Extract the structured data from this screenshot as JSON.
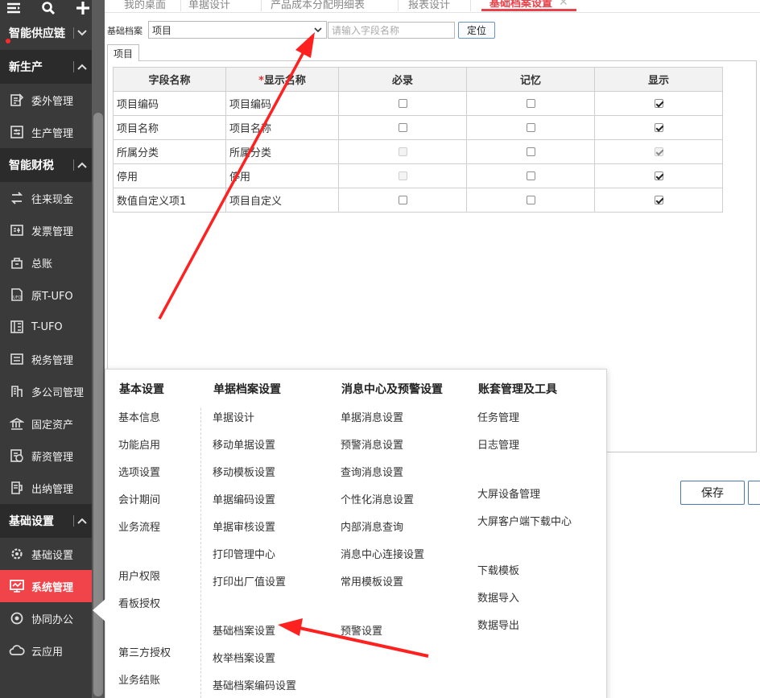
{
  "sidebar": {
    "groups": [
      {
        "label": "智能供应链",
        "items": []
      },
      {
        "label": "新生产",
        "items": [
          "委外管理",
          "生产管理"
        ]
      },
      {
        "label": "智能财税",
        "items": [
          "往来现金",
          "发票管理",
          "总账",
          "原T-UFO",
          "T-UFO",
          "税务管理",
          "多公司管理",
          "固定资产",
          "薪资管理",
          "出纳管理"
        ]
      },
      {
        "label": "基础设置",
        "items": [
          "基础设置",
          "系统管理",
          "协同办公",
          "云应用"
        ]
      }
    ],
    "active_item": "系统管理"
  },
  "tabs": [
    "我的桌面",
    "单据设计",
    "产品成本分配明细表",
    "报表设计",
    "基础档案设置"
  ],
  "active_tab": "基础档案设置",
  "filter": {
    "label": "基础档案",
    "selected": "项目",
    "search_placeholder": "请输入字段名称",
    "locate_label": "定位"
  },
  "subtab": "项目",
  "grid": {
    "headers": [
      "字段名称",
      "显示名称",
      "必录",
      "记忆",
      "显示"
    ],
    "rows": [
      {
        "field": "项目编码",
        "display": "项目编码",
        "required": false,
        "required_disabled": false,
        "memory": false,
        "show": true,
        "show_disabled": false
      },
      {
        "field": "项目名称",
        "display": "项目名称",
        "required": false,
        "required_disabled": false,
        "memory": false,
        "show": true,
        "show_disabled": false
      },
      {
        "field": "所属分类",
        "display": "所属分类",
        "required": false,
        "required_disabled": true,
        "memory": false,
        "show": true,
        "show_disabled": true
      },
      {
        "field": "停用",
        "display": "停用",
        "required": false,
        "required_disabled": true,
        "memory": false,
        "show": true,
        "show_disabled": false
      },
      {
        "field": "数值自定义项1",
        "display": "项目自定义",
        "required": false,
        "required_disabled": false,
        "memory": false,
        "show": true,
        "show_disabled": false
      }
    ]
  },
  "buttons": {
    "save": "保存"
  },
  "menu": {
    "columns": [
      {
        "title": "基本设置",
        "items": [
          "基本信息",
          "功能启用",
          "选项设置",
          "会计期间",
          "业务流程",
          "用户权限",
          "看板授权",
          "第三方授权",
          "业务结账"
        ]
      },
      {
        "title": "单据档案设置",
        "items": [
          "单据设计",
          "移动单据设置",
          "移动模板设置",
          "单据编码设置",
          "单据审核设置",
          "打印管理中心",
          "打印出厂值设置",
          "基础档案设置",
          "枚举档案设置",
          "基础档案编码设置"
        ]
      },
      {
        "title": "消息中心及预警设置",
        "items": [
          "单据消息设置",
          "预警消息设置",
          "查询消息设置",
          "个性化消息设置",
          "内部消息查询",
          "消息中心连接设置",
          "常用模板设置",
          "预警设置"
        ]
      },
      {
        "title": "账套管理及工具",
        "items": [
          "任务管理",
          "日志管理",
          "大屏设备管理",
          "大屏客户端下载中心",
          "下载模板",
          "数据导入",
          "数据导出"
        ]
      }
    ]
  },
  "colors": {
    "accent": "#e8434b",
    "sidebar_bg": "#3a3a3a",
    "active_bg": "#f1444a",
    "arrow": "#ff2020"
  }
}
